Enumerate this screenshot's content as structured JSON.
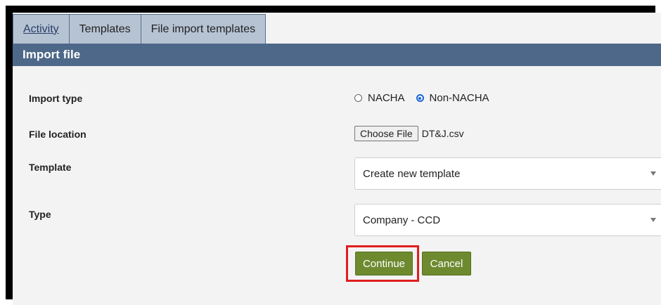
{
  "tabs": [
    {
      "label": "Activity",
      "active": true
    },
    {
      "label": "Templates",
      "active": false
    },
    {
      "label": "File import templates",
      "active": false
    }
  ],
  "header": {
    "title": "Import file"
  },
  "form": {
    "import_type": {
      "label": "Import type",
      "options": [
        "NACHA",
        "Non-NACHA"
      ],
      "selected": "Non-NACHA"
    },
    "file_location": {
      "label": "File location",
      "button_label": "Choose File",
      "file_name": "DT&J.csv"
    },
    "template": {
      "label": "Template",
      "value": "Create new template"
    },
    "type": {
      "label": "Type",
      "value": "Company - CCD"
    }
  },
  "actions": {
    "continue_label": "Continue",
    "cancel_label": "Cancel"
  },
  "colors": {
    "header": "#4d6888",
    "tab_bg": "#b6c3d3",
    "button": "#6d8a2f",
    "highlight": "#e01e1e",
    "radio_accent": "#1a66d6"
  }
}
